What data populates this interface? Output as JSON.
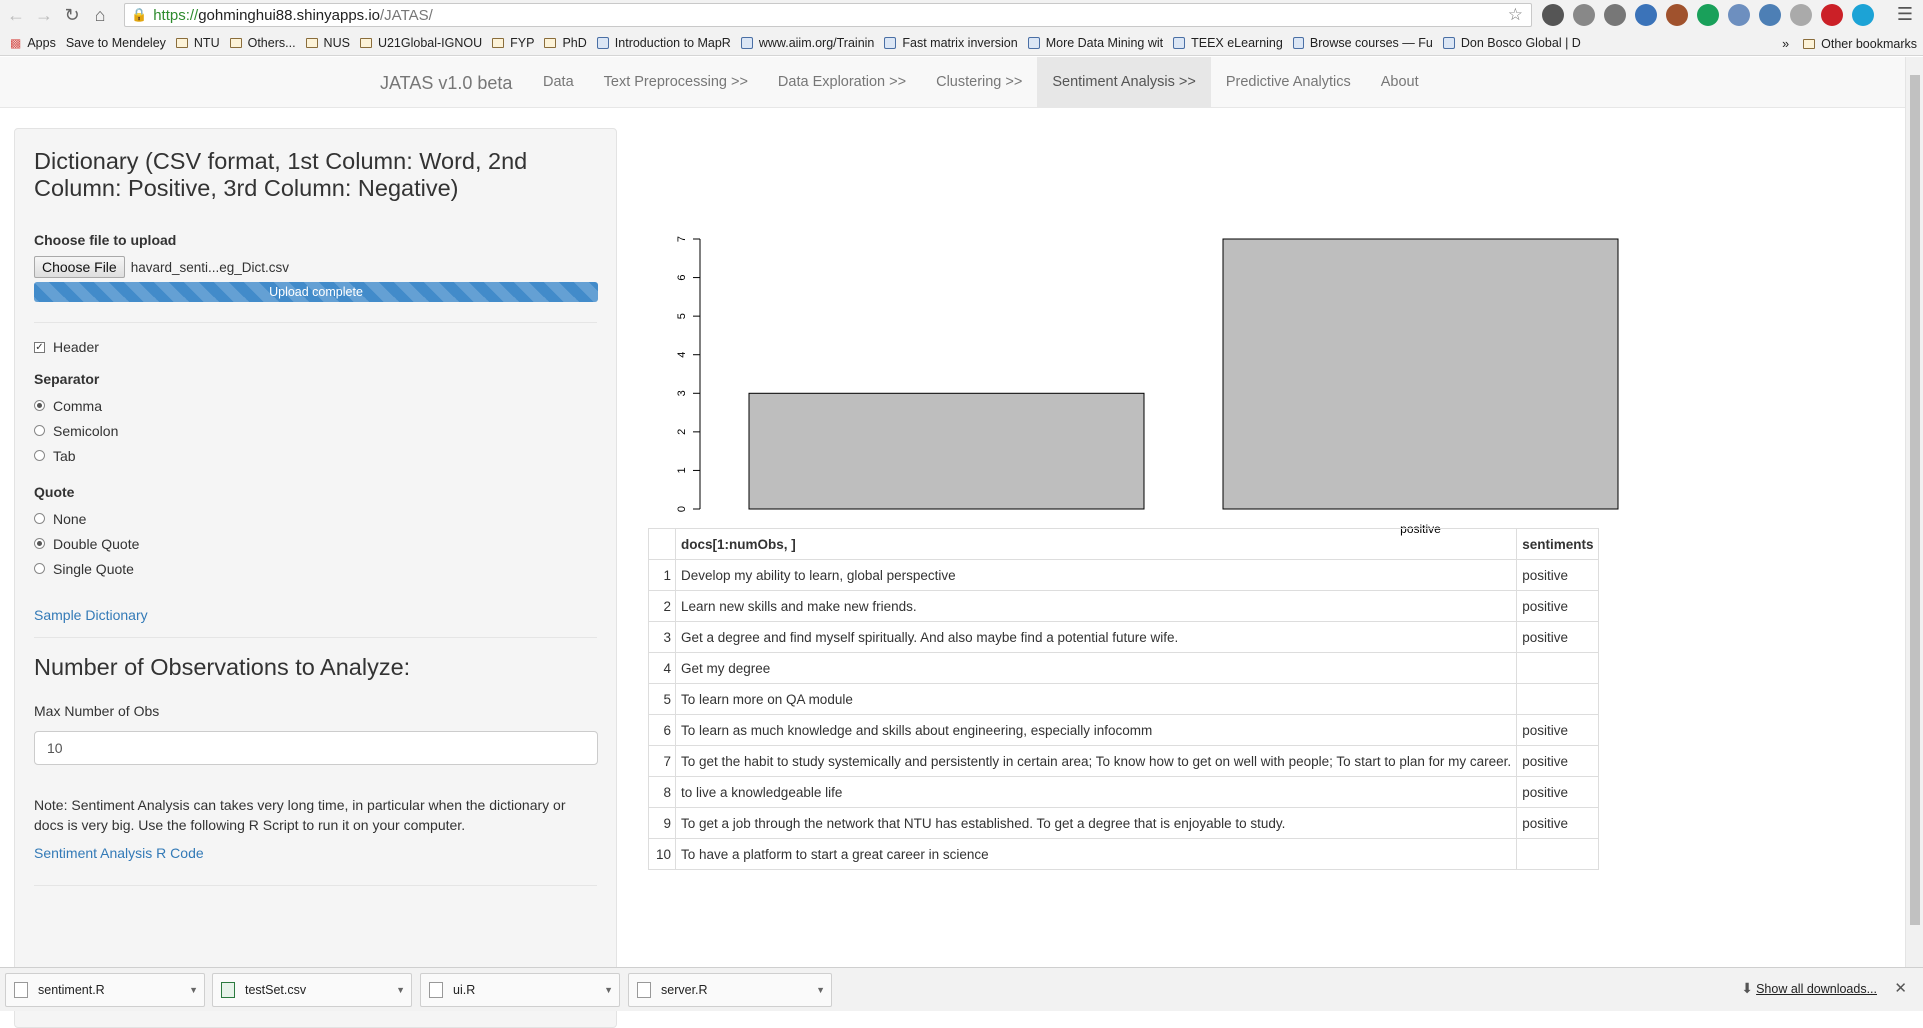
{
  "browser": {
    "url_proto": "https://",
    "url_host": "gohminghui88.shinyapps.io",
    "url_path": "/JATAS/",
    "bookmarks": [
      "Apps",
      "Save to Mendeley",
      "NTU",
      "Others...",
      "NUS",
      "U21Global-IGNOU",
      "FYP",
      "PhD",
      "Introduction to MapR",
      "www.aiim.org/Trainin",
      "Fast matrix inversion",
      "More Data Mining wit",
      "TEEX eLearning",
      "Browse courses — Fu",
      "Don Bosco Global | D"
    ],
    "bookmarks_more": "»",
    "other_bookmarks": "Other bookmarks"
  },
  "app": {
    "brand": "JATAS v1.0 beta",
    "nav": [
      "Data",
      "Text Preprocessing >>",
      "Data Exploration >>",
      "Clustering >>",
      "Sentiment Analysis >>",
      "Predictive Analytics",
      "About"
    ]
  },
  "sidebar": {
    "dict_title": "Dictionary (CSV format, 1st Column: Word, 2nd Column: Positive, 3rd Column: Negative)",
    "file_label": "Choose file to upload",
    "choose_button": "Choose File",
    "file_name": "havard_senti...eg_Dict.csv",
    "progress_text": "Upload complete",
    "header_label": "Header",
    "header_checked": true,
    "separator_label": "Separator",
    "separator_options": [
      "Comma",
      "Semicolon",
      "Tab"
    ],
    "separator_selected": "Comma",
    "quote_label": "Quote",
    "quote_options": [
      "None",
      "Double Quote",
      "Single Quote"
    ],
    "quote_selected": "Double Quote",
    "sample_link": "Sample Dictionary",
    "obs_title": "Number of Observations to Analyze:",
    "max_obs_label": "Max Number of Obs",
    "max_obs_value": "10",
    "note": "Note: Sentiment Analysis can takes very long time, in particular when the dictionary or docs is very big. Use the following R Script to run it on your computer.",
    "code_link": "Sentiment Analysis R Code"
  },
  "chart_data": {
    "type": "bar",
    "categories": [
      "",
      "positive"
    ],
    "values": [
      3,
      7
    ],
    "ylim": [
      0,
      7
    ],
    "yticks": [
      "0",
      "1",
      "2",
      "3",
      "4",
      "5",
      "6",
      "7"
    ],
    "bar_color": "#bebebe"
  },
  "table": {
    "headers": [
      "",
      "docs[1:numObs, ]",
      "sentiments"
    ],
    "rows": [
      [
        "1",
        "Develop my ability to learn, global perspective",
        "positive"
      ],
      [
        "2",
        "Learn new skills and make new friends.",
        "positive"
      ],
      [
        "3",
        "Get a degree and find myself spiritually. And also maybe find a potential future wife.",
        "positive"
      ],
      [
        "4",
        "Get my degree",
        ""
      ],
      [
        "5",
        "To learn more on QA module",
        ""
      ],
      [
        "6",
        "To learn as much knowledge and skills about engineering, especially infocomm",
        "positive"
      ],
      [
        "7",
        "To get the habit to study systemically and persistently in certain area; To know how to get on well with people; To start to plan for my career.",
        "positive"
      ],
      [
        "8",
        "to live a knowledgeable life",
        "positive"
      ],
      [
        "9",
        "To get a job through the network that NTU has established. To get a degree that is enjoyable to study.",
        "positive"
      ],
      [
        "10",
        "To have a platform to start a great career in science",
        ""
      ]
    ]
  },
  "downloads": {
    "items": [
      "sentiment.R",
      "testSet.csv",
      "ui.R",
      "server.R"
    ],
    "show_all": "Show all downloads..."
  }
}
